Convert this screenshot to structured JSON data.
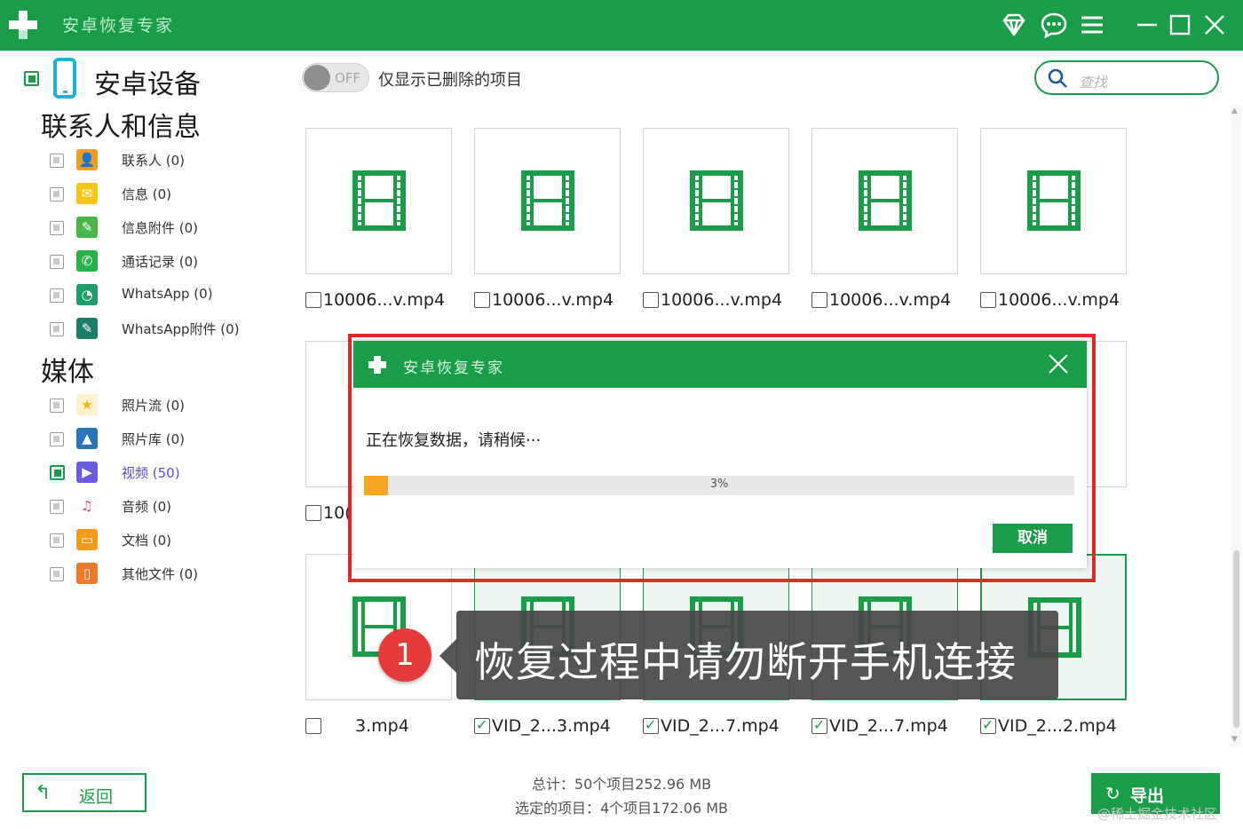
{
  "app": {
    "title": "安卓恢复专家"
  },
  "sidebar": {
    "device_label": "安卓设备",
    "section_messages": "联系人和信息",
    "section_media": "媒体",
    "messages": [
      {
        "label": "联系人 (0)",
        "icon": "contacts-icon",
        "color": "#f39c1f"
      },
      {
        "label": "信息 (0)",
        "icon": "messages-icon",
        "color": "#f5c518"
      },
      {
        "label": "信息附件 (0)",
        "icon": "attachment-icon",
        "color": "#49b649"
      },
      {
        "label": "通话记录 (0)",
        "icon": "phone-icon",
        "color": "#27b24a"
      },
      {
        "label": "WhatsApp (0)",
        "icon": "whatsapp-icon",
        "color": "#1f9e6a"
      },
      {
        "label": "WhatsApp附件 (0)",
        "icon": "whatsapp-attachment-icon",
        "color": "#1f7b6a"
      }
    ],
    "media": [
      {
        "label": "照片流 (0)",
        "icon": "star-icon",
        "color": "#f4b400"
      },
      {
        "label": "照片库 (0)",
        "icon": "gallery-icon",
        "color": "#2a74b8"
      },
      {
        "label": "视频 (50)",
        "icon": "video-icon",
        "color": "#6a5be0"
      },
      {
        "label": "音频 (0)",
        "icon": "audio-icon",
        "color": "#e04a6a"
      },
      {
        "label": "文档 (0)",
        "icon": "document-icon",
        "color": "#f29b1d"
      },
      {
        "label": "其他文件 (0)",
        "icon": "other-file-icon",
        "color": "#f07a2a"
      }
    ]
  },
  "toolbar": {
    "toggle_text": "OFF",
    "toggle_label": "仅显示已删除的项目",
    "search_placeholder": "查找"
  },
  "grid": {
    "row1": [
      "10006...v.mp4",
      "10006...v.mp4",
      "10006...v.mp4",
      "10006...v.mp4",
      "10006...v.mp4"
    ],
    "row2_partial": "10(",
    "row3": [
      "3.mp4",
      "VID_2...3.mp4",
      "VID_2...7.mp4",
      "VID_2...7.mp4",
      "VID_2...2.mp4"
    ]
  },
  "footer": {
    "back_label": "返回",
    "total": "总计：50个项目252.96 MB",
    "selected": "选定的项目：4个项目172.06 MB",
    "export_label": "导出",
    "watermark": "@稀土掘金技术社区"
  },
  "dialog": {
    "title": "安卓恢复专家",
    "message": "正在恢复数据，请稍候···",
    "progress_percent": 3,
    "progress_text": "3%",
    "cancel_label": "取消"
  },
  "annotation": {
    "badge": "1",
    "text": "恢复过程中请勿断开手机连接"
  },
  "colors": {
    "brand": "#1a9d49",
    "highlight": "#e02a2a",
    "progress": "#f5a623"
  }
}
